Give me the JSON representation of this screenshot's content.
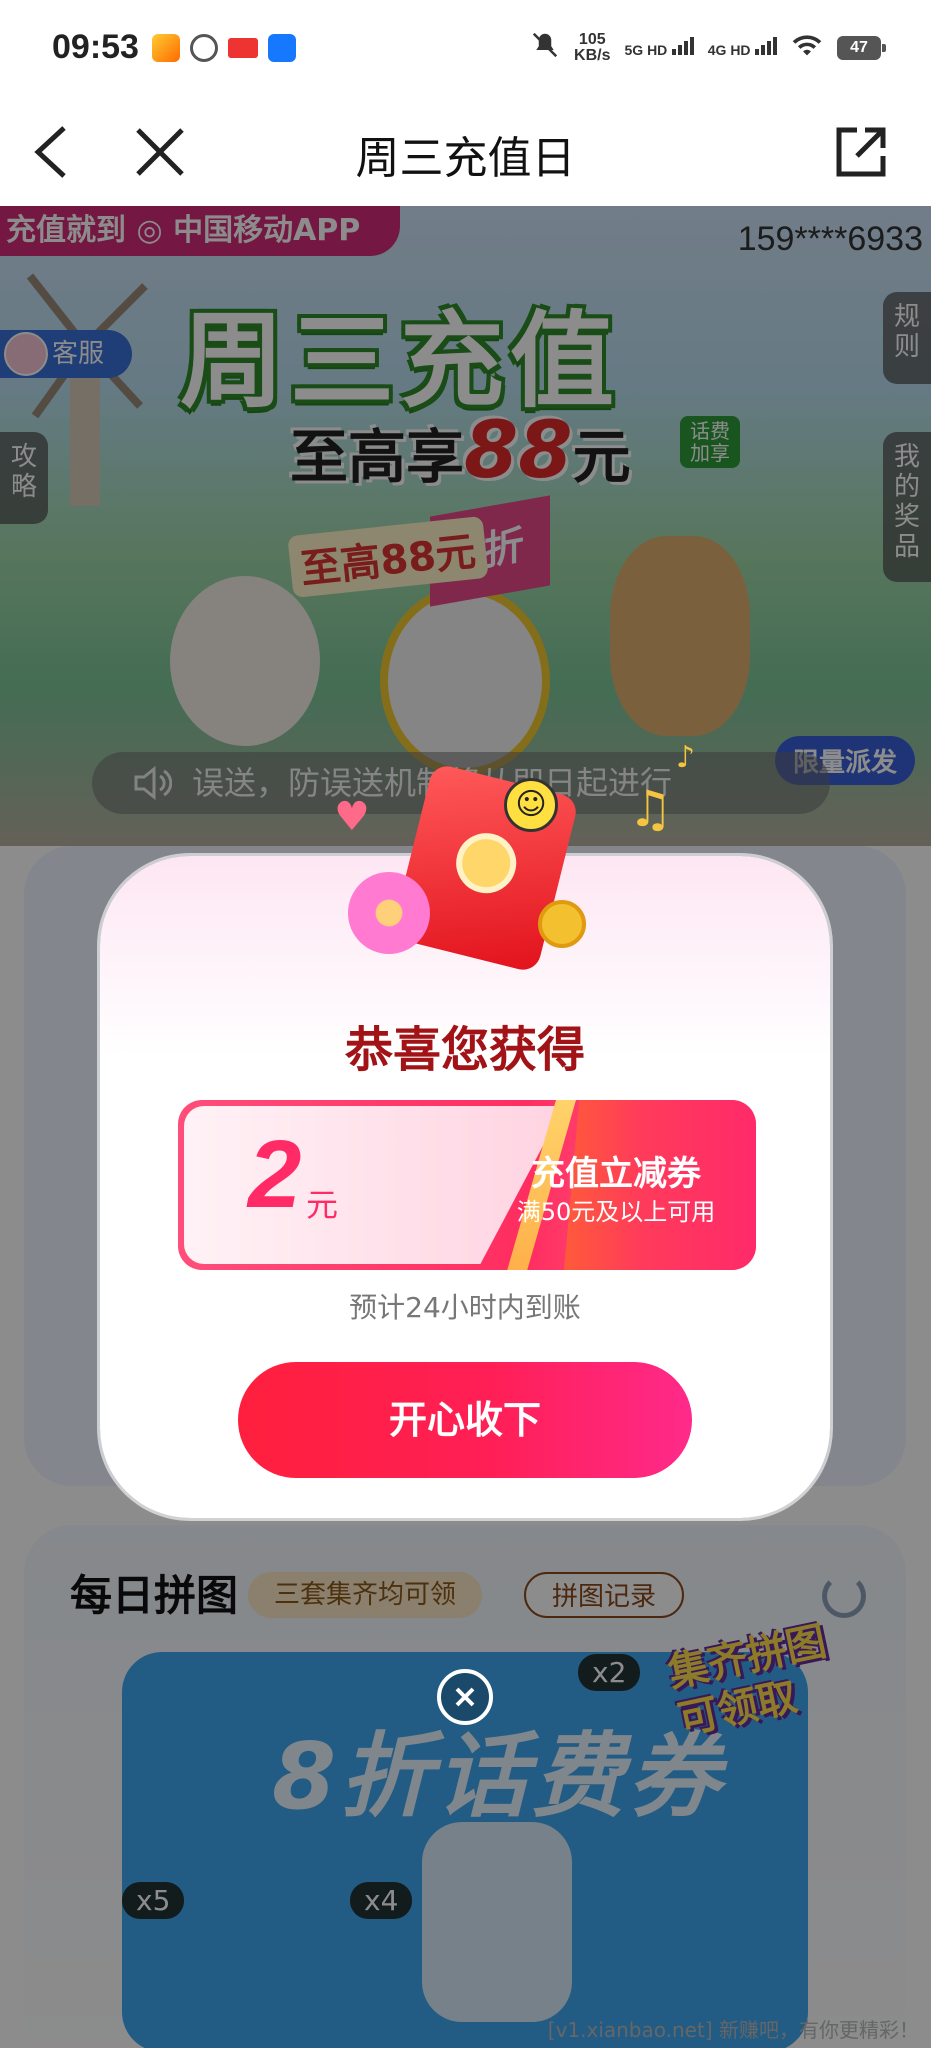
{
  "status_bar": {
    "time": "09:53",
    "net_speed_value": "105",
    "net_speed_unit": "KB/s",
    "sim1_label": "5G HD",
    "sim2_label": "4G HD",
    "battery": "47"
  },
  "nav": {
    "title": "周三充值日",
    "back_icon": "chevron-left-icon",
    "close_icon": "close-icon",
    "share_icon": "share-icon"
  },
  "hero": {
    "tag": "充值就到 ◎ 中国移动APP",
    "phone": "159****6933",
    "title": "周三充值",
    "subtitle_prefix": "至高享",
    "subtitle_amount": "88",
    "subtitle_suffix": "元",
    "badge": "话费加享",
    "customer_service": "客服",
    "rules": "规则",
    "strategy": "攻略",
    "my_prizes": "我的奖品",
    "flag_discount": "8折",
    "chip_amount": "至高88元",
    "limited": "限量派发"
  },
  "marquee": {
    "text": "误送，防误送机制将从即日起进行"
  },
  "section2": {
    "title": "每日拼图",
    "pill_all": "三套集齐均可领",
    "pill_record": "拼图记录",
    "puzzle_text": "8折话费券",
    "badge_x2": "x2",
    "badge_x5": "x5",
    "badge_x4": "x4",
    "collect_text": "集齐拼图可领取"
  },
  "modal": {
    "title": "恭喜您获得",
    "coupon_amount": "2",
    "coupon_unit": "元",
    "coupon_name": "充值立减券",
    "coupon_condition": "满50元及以上可用",
    "eta": "预计24小时内到账",
    "accept_label": "开心收下"
  },
  "watermark": "[v1.xianbao.net] 新赚吧，有你更精彩！",
  "colors": {
    "accent_red": "#ff1f3d",
    "title_dark_red": "#a11316",
    "hero_green": "#2f8a28"
  }
}
